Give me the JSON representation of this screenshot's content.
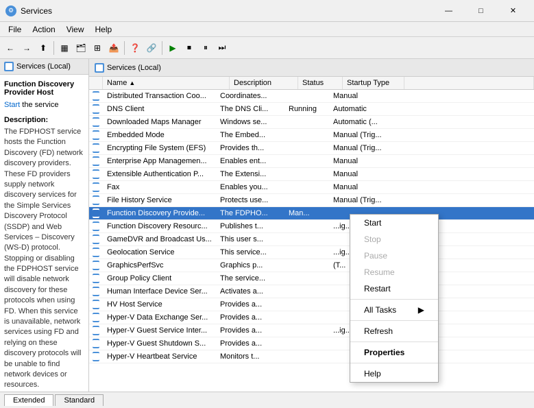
{
  "window": {
    "title": "Services",
    "icon": "⚙"
  },
  "titlebar": {
    "minimize": "—",
    "maximize": "□",
    "close": "✕"
  },
  "menu": {
    "items": [
      "File",
      "Action",
      "View",
      "Help"
    ]
  },
  "left_panel": {
    "header": "Services (Local)",
    "selected_service": "Function Discovery Provider Host",
    "start_link": "Start",
    "start_suffix": " the service",
    "description_title": "Description:",
    "description_text": "The FDPHOST service hosts the Function Discovery (FD) network discovery providers. These FD providers supply network discovery services for the Simple Services Discovery Protocol (SSDP) and Web Services – Discovery (WS-D) protocol. Stopping or disabling the FDPHOST service will disable network discovery for these protocols when using FD. When this service is unavailable, network services using FD and relying on these discovery protocols will be unable to find network devices or resources."
  },
  "right_panel": {
    "header": "Services (Local)"
  },
  "table": {
    "columns": [
      {
        "label": "Name",
        "arrow": "▲"
      },
      {
        "label": "Description"
      },
      {
        "label": "Status"
      },
      {
        "label": "Startup Type"
      }
    ],
    "rows": [
      {
        "icon": true,
        "name": "Distributed Transaction Coo...",
        "desc": "Coordinates...",
        "status": "",
        "startup": "Manual"
      },
      {
        "icon": true,
        "name": "DNS Client",
        "desc": "The DNS Cli...",
        "status": "Running",
        "startup": "Automatic"
      },
      {
        "icon": true,
        "name": "Downloaded Maps Manager",
        "desc": "Windows se...",
        "status": "",
        "startup": "Automatic (..."
      },
      {
        "icon": true,
        "name": "Embedded Mode",
        "desc": "The Embed...",
        "status": "",
        "startup": "Manual (Trig..."
      },
      {
        "icon": true,
        "name": "Encrypting File System (EFS)",
        "desc": "Provides th...",
        "status": "",
        "startup": "Manual (Trig..."
      },
      {
        "icon": true,
        "name": "Enterprise App Managemen...",
        "desc": "Enables ent...",
        "status": "",
        "startup": "Manual"
      },
      {
        "icon": true,
        "name": "Extensible Authentication P...",
        "desc": "The Extensi...",
        "status": "",
        "startup": "Manual"
      },
      {
        "icon": true,
        "name": "Fax",
        "desc": "Enables you...",
        "status": "",
        "startup": "Manual"
      },
      {
        "icon": true,
        "name": "File History Service",
        "desc": "Protects use...",
        "status": "",
        "startup": "Manual (Trig..."
      },
      {
        "icon": true,
        "name": "Function Discovery Provide...",
        "desc": "The FDPHO...",
        "status": "Man...",
        "startup": "",
        "selected": true
      },
      {
        "icon": true,
        "name": "Function Discovery Resourc...",
        "desc": "Publishes t...",
        "status": "",
        "startup": "...ig..."
      },
      {
        "icon": true,
        "name": "GameDVR and Broadcast Us...",
        "desc": "This user s...",
        "status": "",
        "startup": ""
      },
      {
        "icon": true,
        "name": "Geolocation Service",
        "desc": "This service...",
        "status": "",
        "startup": "...ig..."
      },
      {
        "icon": true,
        "name": "GraphicsPerfSvc",
        "desc": "Graphics p...",
        "status": "",
        "startup": "(T..."
      },
      {
        "icon": true,
        "name": "Group Policy Client",
        "desc": "The service...",
        "status": "",
        "startup": ""
      },
      {
        "icon": true,
        "name": "Human Interface Device Ser...",
        "desc": "Activates a...",
        "status": "",
        "startup": ""
      },
      {
        "icon": true,
        "name": "HV Host Service",
        "desc": "Provides a...",
        "status": "",
        "startup": ""
      },
      {
        "icon": true,
        "name": "Hyper-V Data Exchange Ser...",
        "desc": "Provides a...",
        "status": "",
        "startup": ""
      },
      {
        "icon": true,
        "name": "Hyper-V Guest Service Inter...",
        "desc": "Provides a...",
        "status": "",
        "startup": "...ig..."
      },
      {
        "icon": true,
        "name": "Hyper-V Guest Shutdown S...",
        "desc": "Provides a...",
        "status": "",
        "startup": ""
      },
      {
        "icon": true,
        "name": "Hyper-V Heartbeat Service",
        "desc": "Monitors t...",
        "status": "",
        "startup": ""
      }
    ]
  },
  "context_menu": {
    "items": [
      {
        "label": "Start",
        "disabled": false
      },
      {
        "label": "Stop",
        "disabled": true
      },
      {
        "label": "Pause",
        "disabled": true
      },
      {
        "label": "Resume",
        "disabled": true
      },
      {
        "label": "Restart",
        "disabled": false
      },
      {
        "sep": true
      },
      {
        "label": "All Tasks",
        "arrow": "▶",
        "disabled": false
      },
      {
        "sep": true
      },
      {
        "label": "Refresh",
        "disabled": false
      },
      {
        "sep": true
      },
      {
        "label": "Properties",
        "disabled": false
      },
      {
        "sep": true
      },
      {
        "label": "Help",
        "disabled": false
      }
    ]
  },
  "tabs": {
    "extended": "Extended",
    "standard": "Standard"
  },
  "toolbar_icons": [
    "←",
    "→",
    "⬆",
    "🔄",
    "📋",
    "🖫",
    "❌",
    "|",
    "▶",
    "⏹",
    "⏸",
    "⏭"
  ]
}
